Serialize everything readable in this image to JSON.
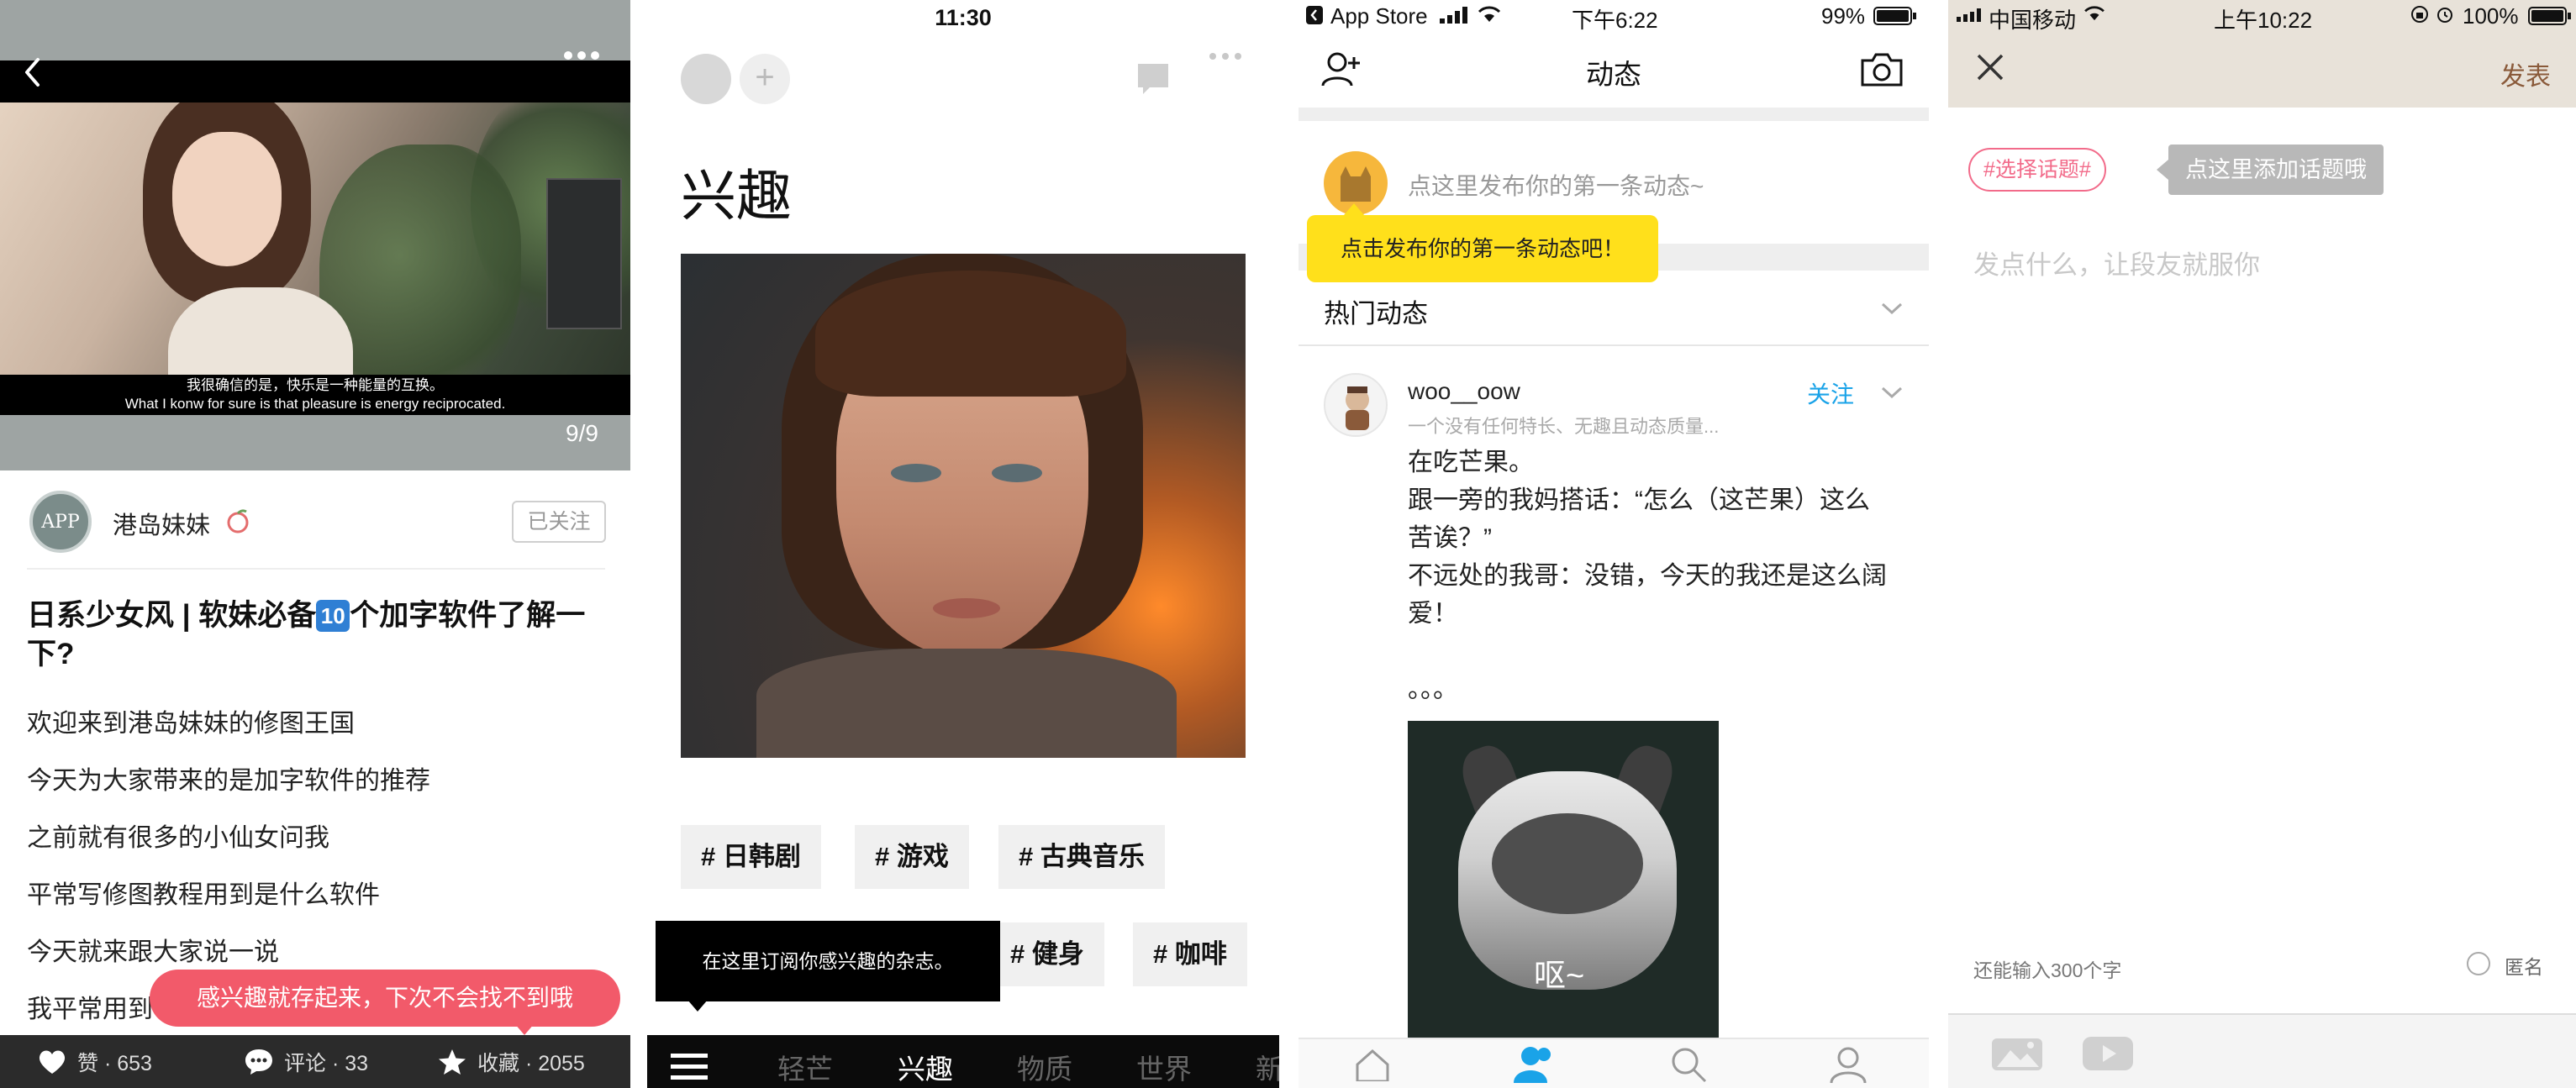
{
  "panel1": {
    "caption_zh": "我很确信的是，快乐是一种能量的互换。",
    "caption_en": "What I konw for sure is that pleasure is energy reciprocated.",
    "pager": "9/9",
    "avatar_text": "APP",
    "author": "港岛妹妹",
    "follow_status": "已关注",
    "title_part1": "日系少女风 | 软妹必备",
    "title_badge": "10",
    "title_part2": "个加字软件了解一下?",
    "body_lines": [
      "欢迎来到港岛妹妹的修图王国",
      "今天为大家带来的是加字软件的推荐",
      "之前就有很多的小仙女问我",
      "平常写修图教程用到是什么软件",
      "今天就来跟大家说一说",
      "我平常用到"
    ],
    "toast": "感兴趣就存起来，下次不会找不到哦",
    "likes": "赞 · 653",
    "comments": "评论 · 33",
    "favorites": "收藏 · 2055"
  },
  "panel2": {
    "time": "11:30",
    "heading": "兴趣",
    "tags_row1": [
      "# 日韩剧",
      "# 游戏",
      "# 古典音乐"
    ],
    "tags_row2": [
      "# 健身",
      "# 咖啡"
    ],
    "tooltip": "在这里订阅你感兴趣的杂志。",
    "tabs": [
      "轻芒",
      "兴趣",
      "物质",
      "世界",
      "新"
    ],
    "active_tab": "兴趣"
  },
  "panel3": {
    "status_left": "App Store",
    "status_time": "下午6:22",
    "status_battery": "99%",
    "nav_title": "动态",
    "post_placeholder": "点这里发布你的第一条动态~",
    "yellow_tip": "点击发布你的第一条动态吧！",
    "hot_title": "热门动态",
    "username": "woo__oow",
    "user_desc": "一个没有任何特长、无趣且动态质量...",
    "follow": "关注",
    "post_lines": [
      "在吃芒果。",
      "跟一旁的我妈搭话：“怎么（这芒果）这么",
      "苦诶？”",
      "不远处的我哥：没错，今天的我还是这么阔",
      "爱！",
      "",
      "。。。"
    ],
    "gif_text": "呕~"
  },
  "panel4": {
    "carrier": "中国移动",
    "time": "上午10:22",
    "battery": "100%",
    "publish": "发表",
    "topic": "#选择话题#",
    "topic_tip": "点这里添加话题哦",
    "placeholder": "发点什么，让段友就服你",
    "char_count": "还能输入300个字",
    "anonymous": "匿名"
  },
  "colors": {
    "toast_pink": "#f25a6a",
    "follow_blue": "#1aa3e8",
    "tip_yellow": "#ffe01b",
    "topic_pink": "#f26b8a",
    "active_tab_blue": "#1aa3e8"
  }
}
